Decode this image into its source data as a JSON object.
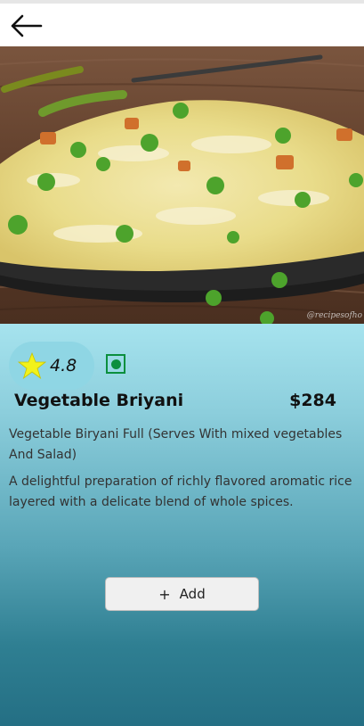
{
  "header": {
    "back_icon": "arrow-left-icon"
  },
  "hero": {
    "watermark": "@recipesofho"
  },
  "product": {
    "rating": "4.8",
    "rating_icon": "star-icon",
    "diet_icon": "veg-indicator-icon",
    "title": "Vegetable Briyani",
    "price": "$284",
    "subtitle": "Vegetable Biryani Full (Serves With mixed vegetables And Salad)",
    "description": "A delightful preparation of richly flavored aromatic rice layered with  a delicate blend of whole spices."
  },
  "actions": {
    "add_icon": "plus-icon",
    "add_label": "Add"
  },
  "colors": {
    "star": "#f2f21a",
    "veg_green": "#0b8f3e",
    "panel_top": "#a6e3ee",
    "panel_bottom": "#246f84"
  }
}
